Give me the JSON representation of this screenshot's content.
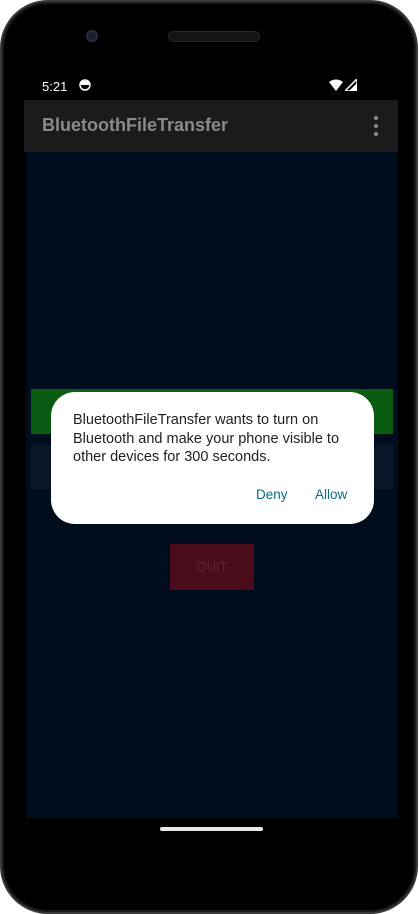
{
  "status_bar": {
    "time": "5:21"
  },
  "app_bar": {
    "title": "BluetoothFileTransfer"
  },
  "main": {
    "quit_label": "QUIT"
  },
  "dialog": {
    "message": "BluetoothFileTransfer wants to turn on Bluetooth and make your phone visible to other devices for 300 seconds.",
    "deny_label": "Deny",
    "allow_label": "Allow"
  },
  "icons": {
    "status_app": "android-face-icon",
    "wifi": "wifi-icon",
    "signal": "cell-signal-icon",
    "overflow": "more-vert-icon"
  },
  "colors": {
    "background": "#000d1c",
    "app_bar": "#1b1b1b",
    "green_button": "#0a5c12",
    "quit_button": "#4a0c1a",
    "dialog_action": "#0b6b7e"
  }
}
